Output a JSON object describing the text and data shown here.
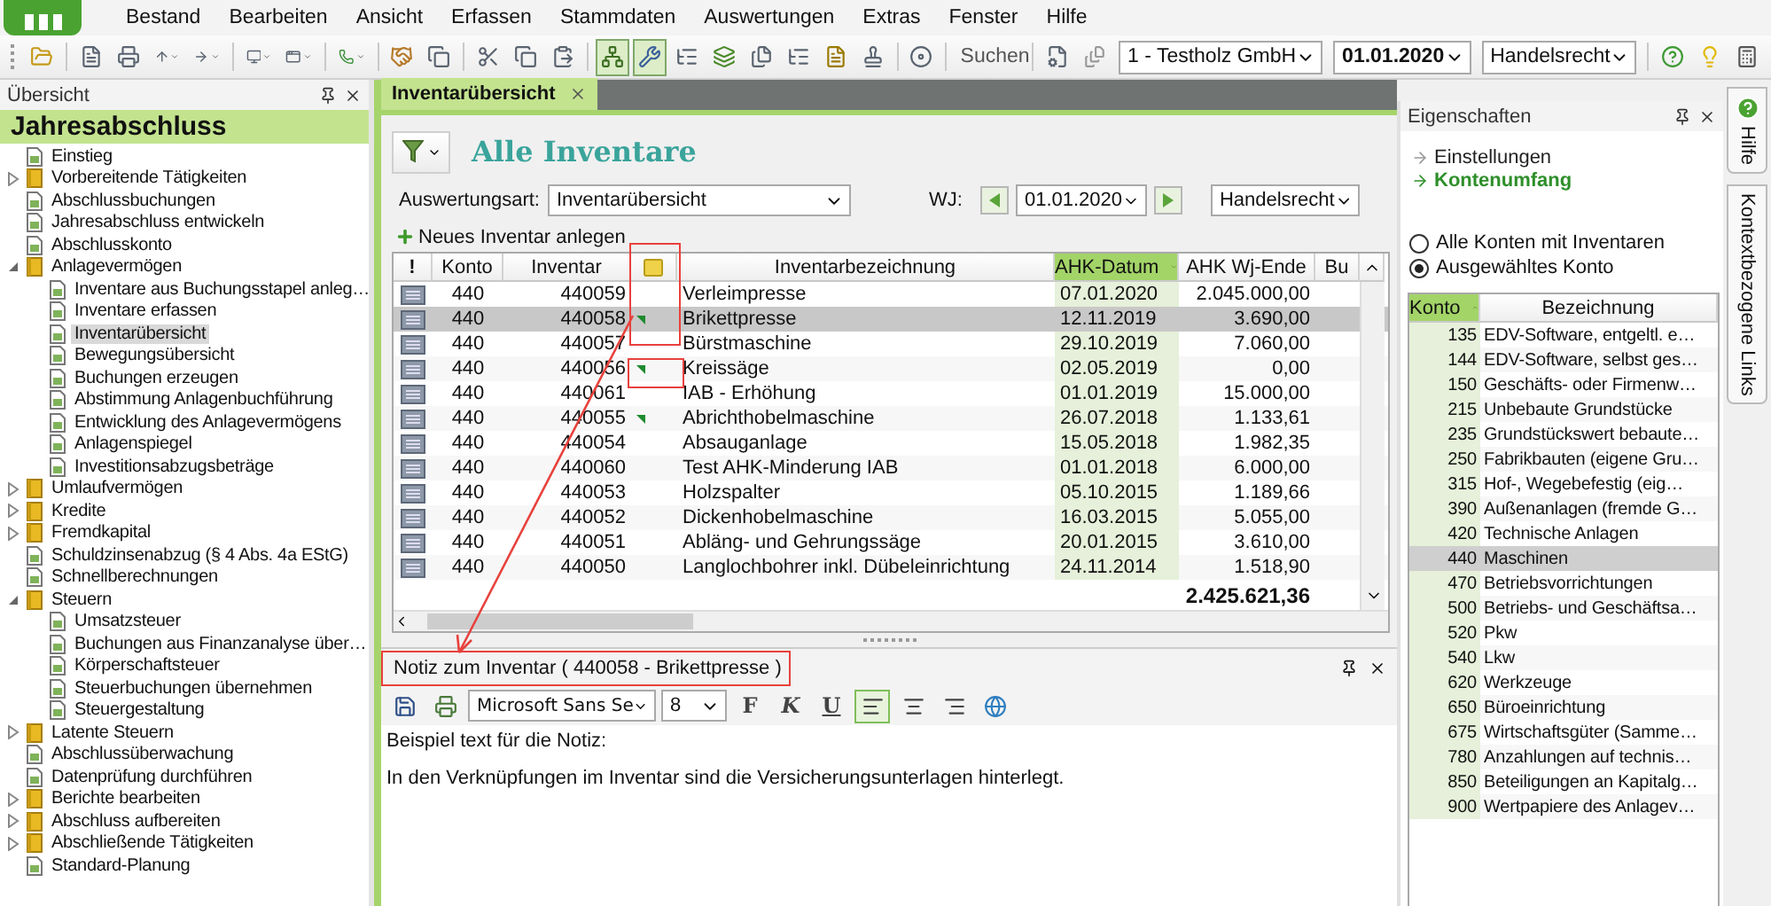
{
  "menu": [
    "Bestand",
    "Bearbeiten",
    "Ansicht",
    "Erfassen",
    "Stammdaten",
    "Auswertungen",
    "Extras",
    "Fenster",
    "Hilfe"
  ],
  "toolbar": {
    "tools": [
      {
        "pressed": false
      },
      {
        "pressed": false
      },
      {
        "pressed": false
      },
      {
        "pressed": false
      },
      {
        "pressed": false
      },
      {
        "pressed": false
      },
      {
        "pressed": false
      },
      {
        "pressed": false
      },
      {
        "pressed": false
      },
      {
        "pressed": false
      },
      {
        "pressed": false
      },
      {
        "pressed": false
      },
      {
        "pressed": false
      },
      {
        "pressed": true
      },
      {
        "pressed": true
      },
      {
        "pressed": false
      },
      {
        "pressed": false
      },
      {
        "pressed": false
      },
      {
        "pressed": false
      },
      {
        "pressed": false
      },
      {
        "pressed": false
      },
      {
        "pressed": false
      }
    ],
    "search": "Suchen",
    "company": "1 - Testholz GmbH",
    "date": "01.01.2020",
    "law": "Handelsrecht"
  },
  "sidebar": {
    "title": "Übersicht",
    "heading": "Jahresabschluss",
    "items": [
      {
        "label": "Einstieg",
        "kind": "page",
        "selected": false
      },
      {
        "label": "Vorbereitende Tätigkeiten",
        "kind": "folder",
        "expanded": false,
        "selected": false
      },
      {
        "label": "Abschlussbuchungen",
        "kind": "page",
        "selected": false
      },
      {
        "label": "Jahresabschluss entwickeln",
        "kind": "page",
        "selected": false
      },
      {
        "label": "Abschlusskonto",
        "kind": "page",
        "selected": false
      },
      {
        "label": "Anlagevermögen",
        "kind": "folder",
        "expanded": true,
        "selected": false,
        "children": [
          {
            "label": "Inventare aus Buchungsstapel anleg…",
            "kind": "page",
            "selected": false
          },
          {
            "label": "Inventare erfassen",
            "kind": "page",
            "selected": false
          },
          {
            "label": "Inventarübersicht",
            "kind": "page",
            "selected": true
          },
          {
            "label": "Bewegungsübersicht",
            "kind": "page",
            "selected": false
          },
          {
            "label": "Buchungen erzeugen",
            "kind": "page",
            "selected": false
          },
          {
            "label": "Abstimmung Anlagenbuchführung",
            "kind": "page",
            "selected": false
          },
          {
            "label": "Entwicklung des Anlagevermögens",
            "kind": "page",
            "selected": false
          },
          {
            "label": "Anlagenspiegel",
            "kind": "page",
            "selected": false
          },
          {
            "label": "Investitionsabzugsbeträge",
            "kind": "page",
            "selected": false
          }
        ]
      },
      {
        "label": "Umlaufvermögen",
        "kind": "folder",
        "expanded": false,
        "selected": false
      },
      {
        "label": "Kredite",
        "kind": "folder",
        "expanded": false,
        "selected": false
      },
      {
        "label": "Fremdkapital",
        "kind": "folder",
        "expanded": false,
        "selected": false
      },
      {
        "label": "Schuldzinsenabzug (§ 4 Abs. 4a EStG)",
        "kind": "page",
        "selected": false
      },
      {
        "label": "Schnellberechnungen",
        "kind": "page",
        "selected": false
      },
      {
        "label": "Steuern",
        "kind": "folder",
        "expanded": true,
        "selected": false,
        "children": [
          {
            "label": "Umsatzsteuer",
            "kind": "page",
            "selected": false
          },
          {
            "label": "Buchungen aus Finanzanalyse über…",
            "kind": "page",
            "selected": false
          },
          {
            "label": "Körperschaftsteuer",
            "kind": "page",
            "selected": false
          },
          {
            "label": "Steuerbuchungen übernehmen",
            "kind": "page",
            "selected": false
          },
          {
            "label": "Steuergestaltung",
            "kind": "page",
            "selected": false
          }
        ]
      },
      {
        "label": "Latente Steuern",
        "kind": "folder",
        "expanded": false,
        "selected": false
      },
      {
        "label": "Abschlussüberwachung",
        "kind": "page",
        "selected": false
      },
      {
        "label": "Datenprüfung durchführen",
        "kind": "page",
        "selected": false
      },
      {
        "label": "Berichte bearbeiten",
        "kind": "folder",
        "expanded": false,
        "selected": false
      },
      {
        "label": "Abschluss aufbereiten",
        "kind": "folder",
        "expanded": false,
        "selected": false
      },
      {
        "label": "Abschließende Tätigkeiten",
        "kind": "folder",
        "expanded": false,
        "selected": false
      },
      {
        "label": "Standard-Planung",
        "kind": "page",
        "selected": false
      }
    ]
  },
  "document_tabs": [
    {
      "label": "Inventarübersicht",
      "selected": true
    }
  ],
  "inventory": {
    "title": "Alle Inventare",
    "report_type_label": "Auswertungsart:",
    "report_type": "Inventarübersicht",
    "fiscal_year_label": "WJ:",
    "fiscal_year": "01.01.2020",
    "law": "Handelsrecht",
    "new_action": "Neues Inventar anlegen",
    "columns": [
      {
        "kind": "flag",
        "label": "!",
        "sorted": false
      },
      {
        "kind": "text",
        "label": "Konto",
        "sorted": false
      },
      {
        "kind": "text",
        "label": "Inventar",
        "sorted": false
      },
      {
        "kind": "note",
        "sorted": false
      },
      {
        "kind": "text",
        "label": "Inventarbezeichnung",
        "sorted": false
      },
      {
        "kind": "text",
        "label": "AHK-Datum",
        "sorted": true
      },
      {
        "kind": "text",
        "label": "AHK Wj-Ende",
        "sorted": false
      },
      {
        "kind": "text",
        "label": "Bu",
        "sorted": false
      }
    ],
    "rows": [
      {
        "konto": "440",
        "inventar": "440059",
        "note": false,
        "bezeichnung": "Verleimpresse",
        "datum": "07.01.2020",
        "wert": "2.045.000,00",
        "selected": false
      },
      {
        "konto": "440",
        "inventar": "440058",
        "note": true,
        "bezeichnung": "Brikettpresse",
        "datum": "12.11.2019",
        "wert": "3.690,00",
        "selected": true
      },
      {
        "konto": "440",
        "inventar": "440057",
        "note": false,
        "bezeichnung": "Bürstmaschine",
        "datum": "29.10.2019",
        "wert": "7.060,00",
        "selected": false
      },
      {
        "konto": "440",
        "inventar": "440056",
        "note": true,
        "bezeichnung": "Kreissäge",
        "datum": "02.05.2019",
        "wert": "0,00",
        "selected": false
      },
      {
        "konto": "440",
        "inventar": "440061",
        "note": false,
        "bezeichnung": "IAB - Erhöhung",
        "datum": "01.01.2019",
        "wert": "15.000,00",
        "selected": false
      },
      {
        "konto": "440",
        "inventar": "440055",
        "note": true,
        "bezeichnung": "Abrichthobelmaschine",
        "datum": "26.07.2018",
        "wert": "1.133,61",
        "selected": false
      },
      {
        "konto": "440",
        "inventar": "440054",
        "note": false,
        "bezeichnung": "Absauganlage",
        "datum": "15.05.2018",
        "wert": "1.982,35",
        "selected": false
      },
      {
        "konto": "440",
        "inventar": "440060",
        "note": false,
        "bezeichnung": "Test AHK-Minderung IAB",
        "datum": "01.01.2018",
        "wert": "6.000,00",
        "selected": false
      },
      {
        "konto": "440",
        "inventar": "440053",
        "note": false,
        "bezeichnung": "Holzspalter",
        "datum": "05.10.2015",
        "wert": "1.189,66",
        "selected": false
      },
      {
        "konto": "440",
        "inventar": "440052",
        "note": false,
        "bezeichnung": "Dickenhobelmaschine",
        "datum": "16.03.2015",
        "wert": "5.055,00",
        "selected": false
      },
      {
        "konto": "440",
        "inventar": "440051",
        "note": false,
        "bezeichnung": "Abläng- und Gehrungssäge",
        "datum": "20.01.2015",
        "wert": "3.610,00",
        "selected": false
      },
      {
        "konto": "440",
        "inventar": "440050",
        "note": false,
        "bezeichnung": "Langlochbohrer inkl. Dübeleinrichtung",
        "datum": "24.11.2014",
        "wert": "1.518,90",
        "selected": false
      }
    ],
    "total": "2.425.621,36"
  },
  "note_panel": {
    "title": "Notiz zum Inventar ( 440058 - Brikettpresse )",
    "font": "Microsoft Sans Se",
    "size": "8",
    "format_buttons": [
      "F",
      "K",
      "U"
    ],
    "align": [
      {
        "selected": true
      },
      {
        "selected": false
      },
      {
        "selected": false
      }
    ],
    "paragraphs": [
      "Beispiel text für die Notiz:",
      "In den Verknüpfungen im Inventar sind die Versicherungsunterlagen hinterlegt."
    ]
  },
  "properties": {
    "title": "Eigenschaften",
    "links": [
      {
        "label": "Einstellungen",
        "selected": false
      },
      {
        "label": "Kontenumfang",
        "selected": true
      }
    ],
    "options": [
      {
        "label": "Alle Konten mit Inventaren",
        "selected": false
      },
      {
        "label": "Ausgewähltes Konto",
        "selected": true
      }
    ],
    "columns": [
      {
        "label": "Konto",
        "sorted": true
      },
      {
        "label": "Bezeichnung",
        "sorted": false
      }
    ],
    "rows": [
      {
        "konto": "135",
        "bezeichnung": "EDV-Software, entgeltl. e…",
        "selected": false
      },
      {
        "konto": "144",
        "bezeichnung": "EDV-Software, selbst ges…",
        "selected": false
      },
      {
        "konto": "150",
        "bezeichnung": "Geschäfts- oder Firmenw…",
        "selected": false
      },
      {
        "konto": "215",
        "bezeichnung": "Unbebaute Grundstücke",
        "selected": false
      },
      {
        "konto": "235",
        "bezeichnung": "Grundstückswert bebaute…",
        "selected": false
      },
      {
        "konto": "250",
        "bezeichnung": "Fabrikbauten (eigene Gru…",
        "selected": false
      },
      {
        "konto": "315",
        "bezeichnung": "Hof-, Wegebefestig (eig…",
        "selected": false
      },
      {
        "konto": "390",
        "bezeichnung": "Außenanlagen (fremde G…",
        "selected": false
      },
      {
        "konto": "420",
        "bezeichnung": "Technische Anlagen",
        "selected": false
      },
      {
        "konto": "440",
        "bezeichnung": "Maschinen",
        "selected": true
      },
      {
        "konto": "470",
        "bezeichnung": "Betriebsvorrichtungen",
        "selected": false
      },
      {
        "konto": "500",
        "bezeichnung": "Betriebs- und Geschäftsa…",
        "selected": false
      },
      {
        "konto": "520",
        "bezeichnung": "Pkw",
        "selected": false
      },
      {
        "konto": "540",
        "bezeichnung": "Lkw",
        "selected": false
      },
      {
        "konto": "620",
        "bezeichnung": "Werkzeuge",
        "selected": false
      },
      {
        "konto": "650",
        "bezeichnung": "Büroeinrichtung",
        "selected": false
      },
      {
        "konto": "675",
        "bezeichnung": "Wirtschaftsgüter (Samme…",
        "selected": false
      },
      {
        "konto": "780",
        "bezeichnung": "Anzahlungen auf technis…",
        "selected": false
      },
      {
        "konto": "850",
        "bezeichnung": "Beteiligungen an Kapitalg…",
        "selected": false
      },
      {
        "konto": "900",
        "bezeichnung": "Wertpapiere des Anlagev…",
        "selected": false
      }
    ]
  },
  "side_tabs": [
    {
      "label": "Hilfe",
      "kind": "help"
    },
    {
      "label": "Kontextbezogene Links",
      "kind": "plain"
    }
  ]
}
